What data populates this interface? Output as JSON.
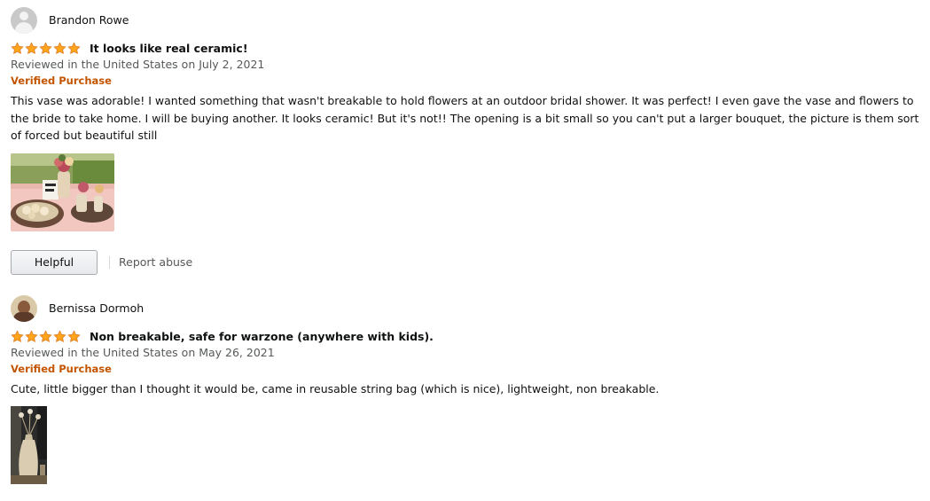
{
  "reviews": [
    {
      "author": "Brandon Rowe",
      "rating": 5,
      "title": "It looks like real ceramic!",
      "date_line": "Reviewed in the United States on July 2, 2021",
      "verified_label": "Verified Purchase",
      "body": "This vase was adorable! I wanted something that wasn't breakable to hold flowers at an outdoor bridal shower. It was perfect! I even gave the vase and flowers to the bride to take home. I will be buying another. It looks ceramic! But it's not!! The opening is a bit small so you can't put a larger bouquet, the picture is them sort of forced but beautiful still",
      "helpful_label": "Helpful",
      "report_label": "Report abuse"
    },
    {
      "author": "Bernissa Dormoh",
      "rating": 5,
      "title": "Non breakable, safe for warzone (anywhere with kids).",
      "date_line": "Reviewed in the United States on May 26, 2021",
      "verified_label": "Verified Purchase",
      "body": "Cute, little bigger than I thought it would be, came in reusable string bag (which is nice), lightweight, non breakable."
    }
  ],
  "colors": {
    "star_fill": "#ffa41c",
    "star_stroke": "#de7921",
    "verified": "#c45500",
    "muted_text": "#565959"
  }
}
